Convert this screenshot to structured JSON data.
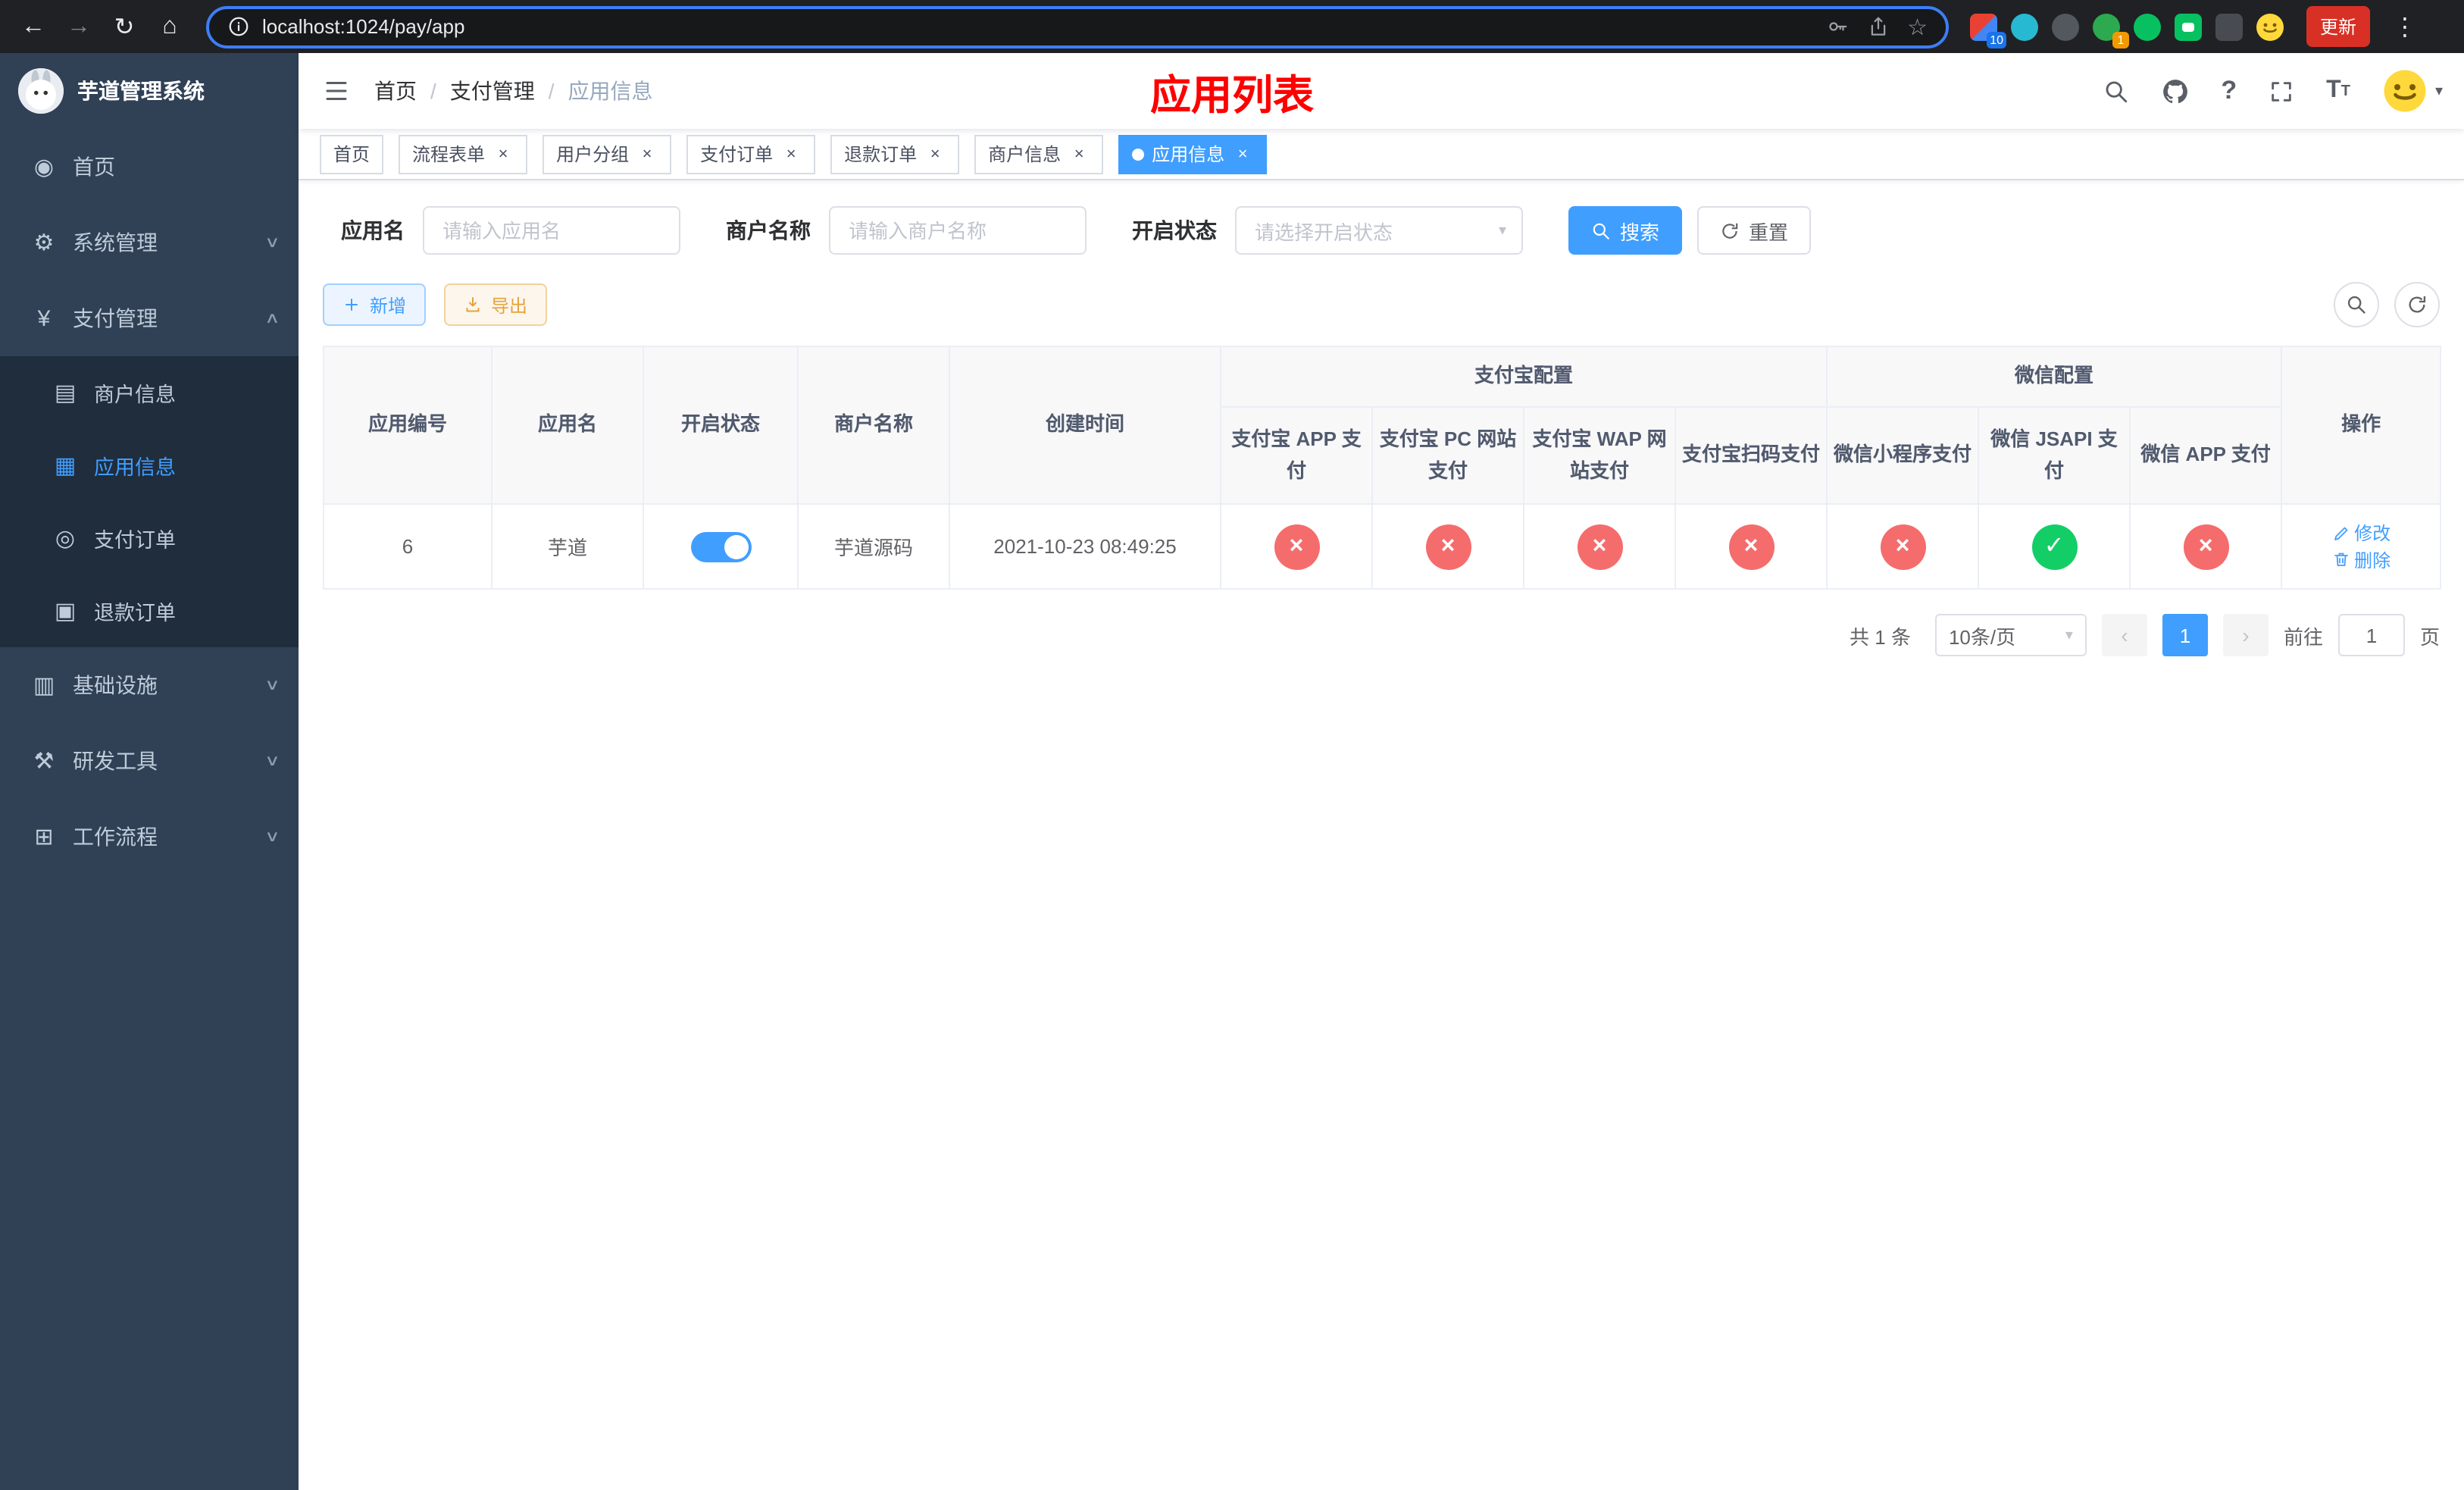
{
  "colors": {
    "accent": "#409eff",
    "danger": "#f56c6c",
    "success": "#13ce66",
    "warning": "#e6a23c",
    "title_red": "#ff0000",
    "sidebar_bg": "#304156",
    "submenu_bg": "#1f2d3d"
  },
  "browser": {
    "url": "localhost:1024/pay/app",
    "update_label": "更新",
    "ext_badge_grid": "10",
    "ext_badge_green": "1"
  },
  "sidebar": {
    "title": "芋道管理系统",
    "items": [
      {
        "label": "首页",
        "glyph": "◉"
      },
      {
        "label": "系统管理",
        "glyph": "⚙"
      },
      {
        "label": "支付管理",
        "glyph": "¥"
      },
      {
        "label": "商户信息",
        "glyph": "▤"
      },
      {
        "label": "应用信息",
        "glyph": "▦"
      },
      {
        "label": "支付订单",
        "glyph": "◎"
      },
      {
        "label": "退款订单",
        "glyph": "▣"
      },
      {
        "label": "基础设施",
        "glyph": "▥"
      },
      {
        "label": "研发工具",
        "glyph": "⚒"
      },
      {
        "label": "工作流程",
        "glyph": "⊞"
      }
    ]
  },
  "header": {
    "breadcrumb": [
      "首页",
      "支付管理",
      "应用信息"
    ],
    "page_title": "应用列表"
  },
  "tags": [
    {
      "label": "首页"
    },
    {
      "label": "流程表单"
    },
    {
      "label": "用户分组"
    },
    {
      "label": "支付订单"
    },
    {
      "label": "退款订单"
    },
    {
      "label": "商户信息"
    },
    {
      "label": "应用信息"
    }
  ],
  "filters": {
    "app_name_label": "应用名",
    "app_name_placeholder": "请输入应用名",
    "merchant_label": "商户名称",
    "merchant_placeholder": "请输入商户名称",
    "status_label": "开启状态",
    "status_placeholder": "请选择开启状态",
    "search_label": "搜索",
    "reset_label": "重置"
  },
  "toolbar": {
    "add_label": "新增",
    "export_label": "导出"
  },
  "table": {
    "groups": {
      "alipay": "支付宝配置",
      "wechat": "微信配置"
    },
    "columns": {
      "id": "应用编号",
      "name": "应用名",
      "status": "开启状态",
      "merchant": "商户名称",
      "created": "创建时间",
      "alipay_app": "支付宝 APP 支付",
      "alipay_pc": "支付宝 PC 网站支付",
      "alipay_wap": "支付宝 WAP 网站支付",
      "alipay_qr": "支付宝扫码支付",
      "wx_mini": "微信小程序支付",
      "wx_jsapi": "微信 JSAPI 支付",
      "wx_app": "微信 APP 支付",
      "actions": "操作"
    },
    "edit_label": "修改",
    "delete_label": "删除",
    "rows": [
      {
        "id": "6",
        "name": "芋道",
        "enabled": true,
        "merchant": "芋道源码",
        "created": "2021-10-23 08:49:25",
        "configs": {
          "alipay_app": false,
          "alipay_pc": false,
          "alipay_wap": false,
          "alipay_qr": false,
          "wx_mini": false,
          "wx_jsapi": true,
          "wx_app": false
        }
      }
    ]
  },
  "pagination": {
    "total_text": "共 1 条",
    "page_size": "10条/页",
    "current_page": "1",
    "goto_label": "前往",
    "goto_value": "1",
    "page_suffix": "页"
  }
}
